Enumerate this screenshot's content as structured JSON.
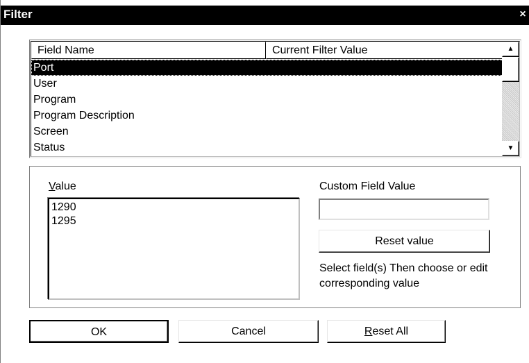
{
  "window": {
    "title": "Filter",
    "close_glyph": "×"
  },
  "list": {
    "columns": [
      "Field Name",
      "Current Filter Value"
    ],
    "rows": [
      {
        "field": "Port",
        "selected": true
      },
      {
        "field": "User",
        "selected": false
      },
      {
        "field": "Program",
        "selected": false
      },
      {
        "field": "Program Description",
        "selected": false
      },
      {
        "field": "Screen",
        "selected": false
      },
      {
        "field": "Status",
        "selected": false
      }
    ],
    "scroll_up_glyph": "▲",
    "scroll_down_glyph": "▼"
  },
  "value_panel": {
    "label_underlined": "V",
    "label_rest": "alue",
    "values": [
      "1290",
      "1295"
    ]
  },
  "custom": {
    "label": "Custom Field Value",
    "input_value": "",
    "reset_value_label": "Reset value",
    "help_text": "Select field(s)  Then choose or edit corresponding value"
  },
  "buttons": {
    "ok": "OK",
    "cancel": "Cancel",
    "reset_all_underlined": "R",
    "reset_all_rest": "eset All"
  }
}
